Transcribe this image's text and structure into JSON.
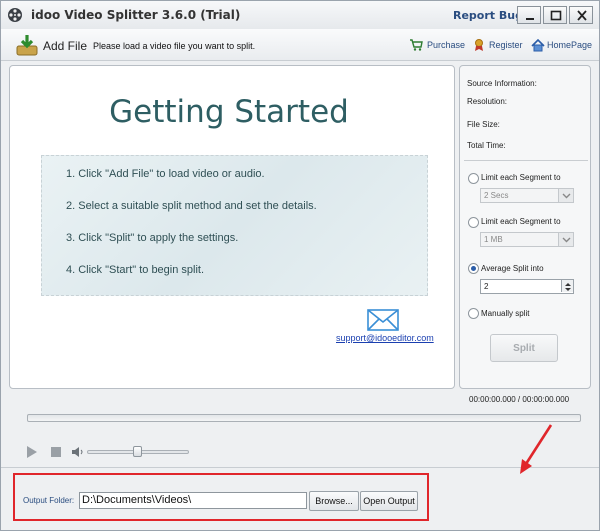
{
  "window": {
    "title": "idoo Video Splitter 3.6.0 (Trial)",
    "report_bugs": "Report Bugs"
  },
  "toolbar": {
    "add_file": "Add File",
    "hint": "Please load a video file you want to split.",
    "purchase": "Purchase",
    "register": "Register",
    "homepage": "HomePage"
  },
  "preview": {
    "title": "Getting Started",
    "steps": [
      "1. Click \"Add File\" to load video or audio.",
      "2. Select a suitable split method and set the details.",
      "3. Click \"Split\" to apply the settings.",
      "4. Click \"Start\" to begin split."
    ],
    "support_email": "support@idooeditor.com"
  },
  "side": {
    "source_info": "Source Information:",
    "resolution": "Resolution:",
    "file_size": "File Size:",
    "total_time": "Total Time:",
    "opt1_label": "Limit each Segment to",
    "opt1_value": "2 Secs",
    "opt2_label": "Limit each Segment to",
    "opt2_value": "1 MB",
    "opt3_label": "Average Split into",
    "opt3_value": "2",
    "opt4_label": "Manually split",
    "selected_option": "Average Split into",
    "split_button": "Split"
  },
  "player": {
    "time": "00:00:00.000 / 00:00:00.000",
    "volume_level": 0.5
  },
  "output": {
    "label": "Output Folder:",
    "path": "D:\\Documents\\Videos\\",
    "browse": "Browse...",
    "open_output": "Open Output"
  },
  "colors": {
    "title_accent": "#2e5e63",
    "link": "#2a4d80",
    "highlight_border": "#e0262b"
  }
}
